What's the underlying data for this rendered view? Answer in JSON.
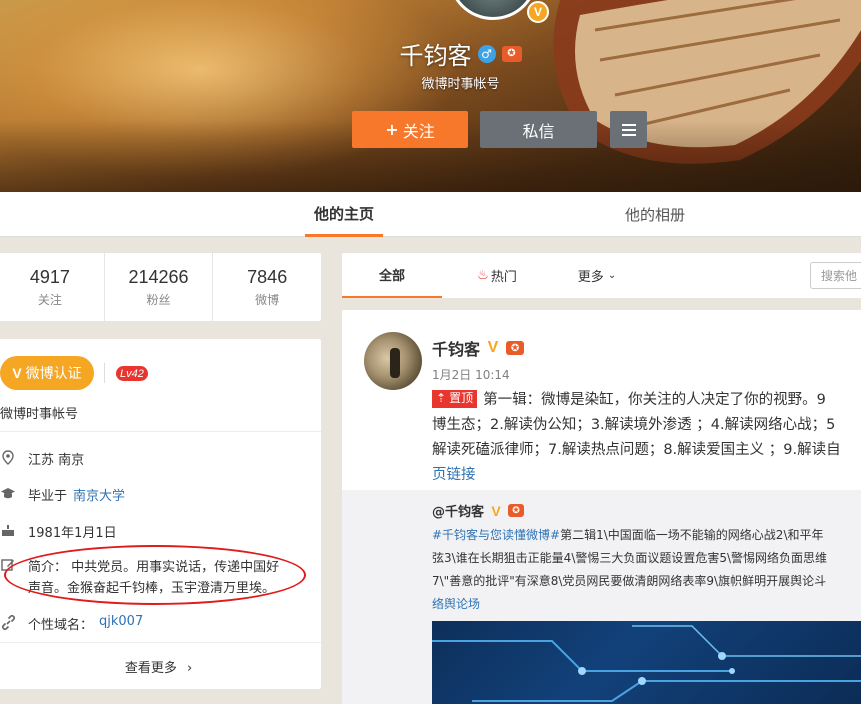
{
  "profile": {
    "name": "千钧客",
    "subtitle": "微博时事帐号",
    "verified_mark": "V",
    "follow_label": "关注",
    "follow_plus": "+",
    "message_label": "私信"
  },
  "tabs": {
    "home": "他的主页",
    "album": "他的相册"
  },
  "stats": [
    {
      "num": "4917",
      "label": "关注"
    },
    {
      "num": "214266",
      "label": "粉丝"
    },
    {
      "num": "7846",
      "label": "微博"
    }
  ],
  "info": {
    "verify_label": "微博认证",
    "verify_mark": "V",
    "level": "Lv42",
    "account_type": "微博时事帐号",
    "location": "江苏 南京",
    "school_prefix": "毕业于",
    "school": "南京大学",
    "birthday": "1981年1月1日",
    "bio_line1": "简介： 中共党员。用事实说话，传递中国好",
    "bio_line2": "声音。金猴奋起千钧棒，玉宇澄清万里埃。",
    "domain_label": "个性域名：",
    "domain": "qjk007",
    "see_more": "查看更多",
    "see_more_arrow": "›"
  },
  "feed_tabs": {
    "all": "全部",
    "hot": "热门",
    "more": "更多",
    "search_placeholder": "搜索他"
  },
  "post": {
    "name": "千钧客",
    "v_mark": "V",
    "date": "1月2日 10:14",
    "pin_label": "置顶",
    "line1": "第一辑：微博是染缸，你关注的人决定了你的视野。9",
    "line2": "博生态；2.解读伪公知；3.解读境外渗透 ；4.解读网络心战；5",
    "line3": "解读死磕派律师；7.解读热点问题；8.解读爱国主义 ；9.解读自",
    "link_text": "页链接"
  },
  "repost": {
    "name": "@千钧客",
    "v_mark": "V",
    "line1_tag": "#千钧客与您读懂微博#",
    "line1": "第二辑1\\中国面临一场不能输的网络心战2\\和平年",
    "line2": "弦3\\谁在长期狙击正能量4\\警惕三大负面议题设置危害5\\警惕网络负面思维",
    "line3": "7\\\"善意的批评\"有深意8\\党员网民要做清朗网络表率9\\旗帜鲜明开展舆论斗",
    "line4_tag": "络舆论场"
  },
  "colors": {
    "accent": "#f7782b",
    "verify": "#f5a623",
    "link": "#2f73b3",
    "annotation": "#e01b1b"
  }
}
